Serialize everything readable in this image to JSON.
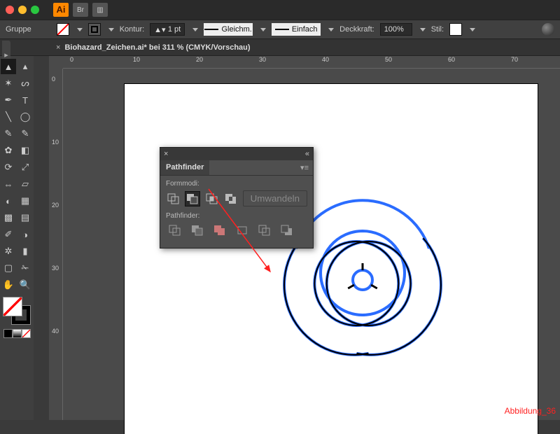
{
  "titlebar": {
    "app_badge": "Ai",
    "bridge_label": "Br"
  },
  "ctrlbar": {
    "selection_label": "Gruppe",
    "stroke_label": "Kontur:",
    "stroke_weight": "1 pt",
    "stroke_profile": "Gleichm.",
    "brush_profile": "Einfach",
    "opacity_label": "Deckkraft:",
    "opacity_value": "100%",
    "style_label": "Stil:"
  },
  "document": {
    "tab_title": "Biohazard_Zeichen.ai* bei 311 % (CMYK/Vorschau)",
    "zoom": "311 %",
    "color_mode": "CMYK",
    "view_mode": "Vorschau"
  },
  "ruler": {
    "h_ticks": [
      "0",
      "10",
      "20",
      "30",
      "40",
      "50",
      "60",
      "70"
    ],
    "v_ticks": [
      "0",
      "10",
      "20",
      "30",
      "40"
    ]
  },
  "pathfinder": {
    "title": "Pathfinder",
    "shape_modes_label": "Formmodi:",
    "expand_btn": "Umwandeln",
    "pathfinder_label": "Pathfinder:",
    "shape_modes": [
      "unite",
      "minus-front",
      "intersect",
      "exclude"
    ],
    "active_shape_mode": "minus-front",
    "pf_ops": [
      "divide",
      "trim",
      "merge",
      "crop",
      "outline",
      "minus-back"
    ]
  },
  "caption": "Abbildung_36"
}
